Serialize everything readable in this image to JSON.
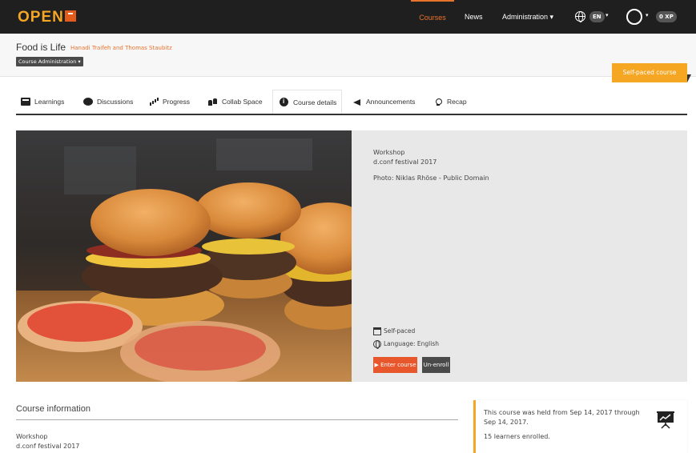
{
  "nav": {
    "logo": "OPEN",
    "items": [
      "Courses",
      "News",
      "Administration ▾"
    ],
    "lang": "EN",
    "lang_caret": "▾",
    "avatar_caret": "▾",
    "xp": "0 XP"
  },
  "course": {
    "title": "Food is Life",
    "teachers": "Hanadi Traifeh and Thomas Staubitz",
    "admin_button": "Course Administration ▾",
    "self_paced_tag": "Self-paced course"
  },
  "tabs": [
    "Learnings",
    "Discussions",
    "Progress",
    "Collab Space",
    "Course details",
    "Announcements",
    "Recap"
  ],
  "hero": {
    "type": "Workshop",
    "event": "d.conf festival 2017",
    "photo_credit": "Photo: Niklas Rhöse - Public Domain",
    "pacing": "Self-paced",
    "language": "Language: English",
    "enter_button": "▶ Enter course",
    "unenroll_button": "Un-enroll"
  },
  "course_info": {
    "title": "Course information",
    "type": "Workshop",
    "event": "d.conf festival 2017"
  },
  "side": {
    "held": "This course was held from Sep 14, 2017 through Sep 14, 2017.",
    "learners": "15 learners enrolled."
  },
  "colors": {
    "accent": "#e8732b",
    "tag": "#f5a623",
    "topbar": "#1f1f1f",
    "enter": "#e8572b"
  }
}
